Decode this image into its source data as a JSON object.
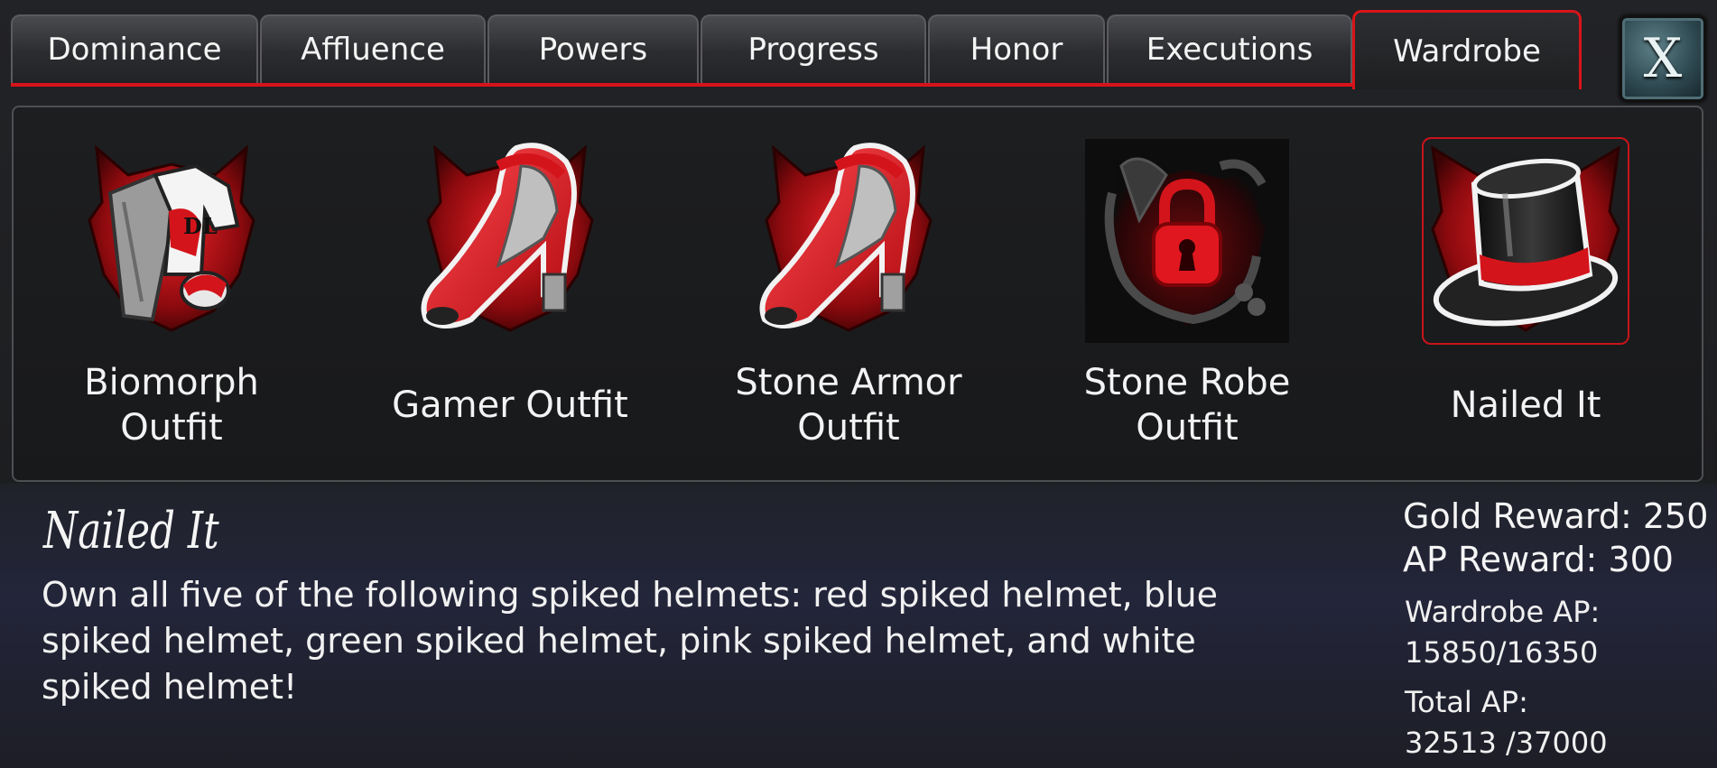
{
  "tabs": [
    {
      "label": "Dominance"
    },
    {
      "label": "Affluence"
    },
    {
      "label": "Powers"
    },
    {
      "label": "Progress"
    },
    {
      "label": "Honor"
    },
    {
      "label": "Executions"
    },
    {
      "label": "Wardrobe"
    }
  ],
  "active_tab": "Wardrobe",
  "close_label": "X",
  "items": [
    {
      "label": "Biomorph\nOutfit",
      "icon": "clothes-icon",
      "locked": false,
      "selected": false
    },
    {
      "label": "Gamer Outfit",
      "icon": "red-high-heel-icon",
      "locked": false,
      "selected": false
    },
    {
      "label": "Stone Armor\nOutfit",
      "icon": "red-high-heel-icon",
      "locked": false,
      "selected": false
    },
    {
      "label": "Stone Robe\nOutfit",
      "icon": "padlock-icon",
      "locked": true,
      "selected": false
    },
    {
      "label": "Nailed It",
      "icon": "top-hat-icon",
      "locked": false,
      "selected": true
    }
  ],
  "detail": {
    "title": "Nailed It",
    "description": "Own all five of the following spiked helmets: red spiked helmet, blue spiked helmet, green spiked helmet, pink spiked helmet, and white spiked helmet!",
    "gold_reward": "Gold Reward: 250",
    "ap_reward": "AP Reward: 300",
    "wardrobe_ap_label": "Wardrobe AP:",
    "wardrobe_ap_value": "15850/16350",
    "total_ap_label": "Total AP:",
    "total_ap_value": "32513 /37000"
  },
  "colors": {
    "accent_red": "#d8141a",
    "panel_bg": "#1b1c1e",
    "close_button": "#2f4a52"
  }
}
